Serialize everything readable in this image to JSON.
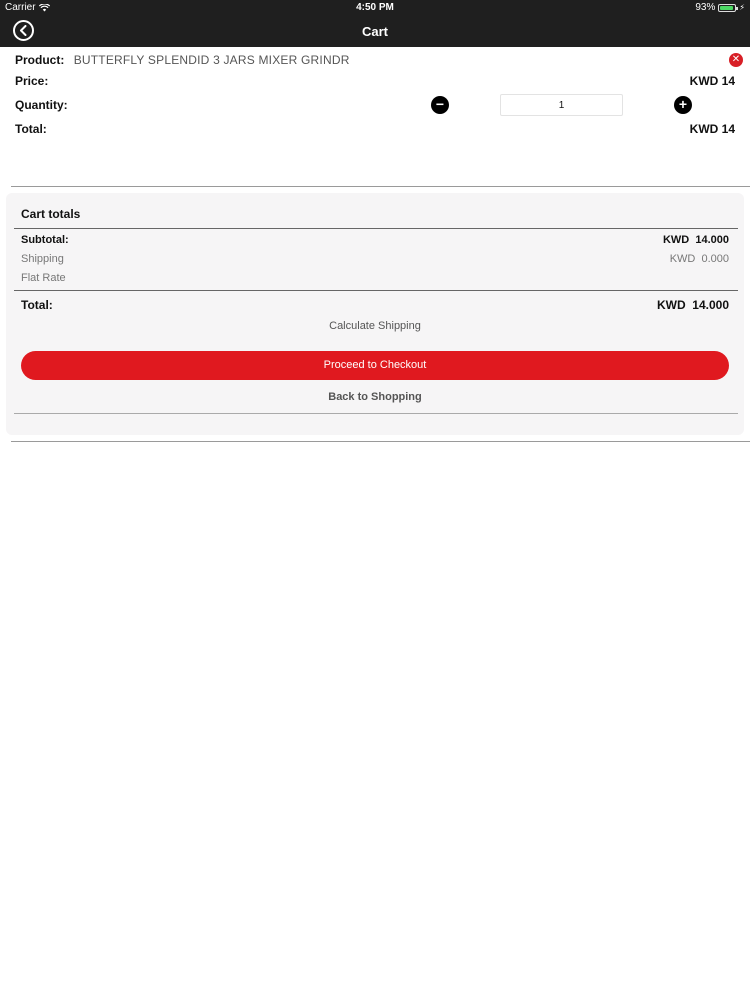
{
  "status_bar": {
    "carrier": "Carrier",
    "time": "4:50 PM",
    "battery": "93%",
    "battery_level": 0.93
  },
  "nav": {
    "title": "Cart",
    "back_icon": "back-arrow-circle-icon"
  },
  "product": {
    "product_label": "Product:",
    "product_name": "BUTTERFLY SPLENDID 3 JARS MIXER GRINDR",
    "price_label": "Price:",
    "price_value": "KWD 14",
    "quantity_label": "Quantity:",
    "quantity_value": "1",
    "total_label": "Total:",
    "total_value": "KWD 14",
    "remove_icon": "remove-x-icon"
  },
  "cart_totals": {
    "title": "Cart totals",
    "subtotal_label": "Subtotal:",
    "subtotal_value": "KWD  14.000",
    "shipping_label": "Shipping",
    "shipping_value": "KWD  0.000",
    "flat_rate_label": "Flat Rate",
    "total_label": "Total:",
    "total_value": "KWD  14.000",
    "calculate_shipping": "Calculate Shipping",
    "checkout_button": "Proceed to Checkout",
    "back_to_shopping": "Back to Shopping"
  },
  "colors": {
    "topbar": "#1f1f1f",
    "accent_red": "#e0191f",
    "panel_bg": "#f6f5f6"
  }
}
